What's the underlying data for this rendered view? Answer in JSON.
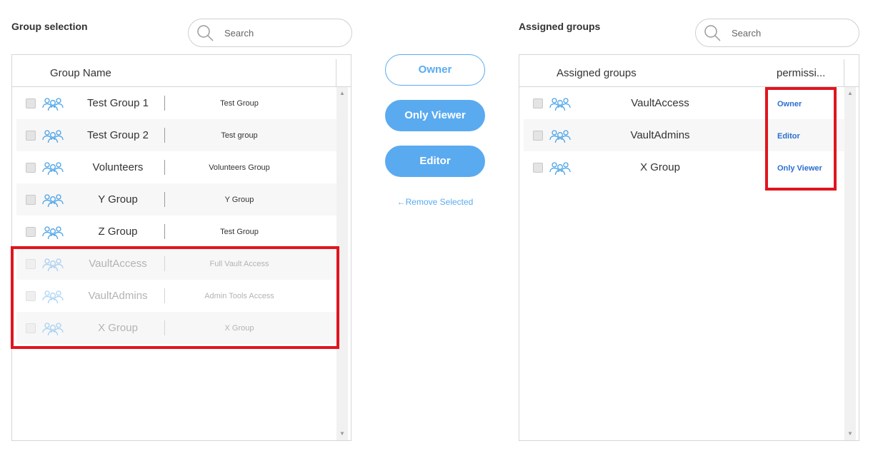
{
  "left": {
    "title": "Group selection",
    "search_placeholder": "Search",
    "header": {
      "name": "Group Name"
    },
    "rows": [
      {
        "name": "Test Group 1",
        "desc": "Test Group"
      },
      {
        "name": "Test Group 2",
        "desc": "Test group"
      },
      {
        "name": "Volunteers",
        "desc": "Volunteers Group"
      },
      {
        "name": "Y Group",
        "desc": "Y Group"
      },
      {
        "name": "Z Group",
        "desc": "Test Group"
      },
      {
        "name": "VaultAccess",
        "desc": "Full Vault Access"
      },
      {
        "name": "VaultAdmins",
        "desc": "Admin Tools Access"
      },
      {
        "name": "X Group",
        "desc": "X Group"
      }
    ]
  },
  "actions": {
    "owner": "Owner",
    "only_viewer": "Only Viewer",
    "editor": "Editor",
    "remove_selected": "←Remove Selected"
  },
  "right": {
    "title": "Assigned groups",
    "search_placeholder": "Search",
    "header": {
      "name": "Assigned groups",
      "permission": "permissi..."
    },
    "rows": [
      {
        "name": "VaultAccess",
        "permission": "Owner"
      },
      {
        "name": "VaultAdmins",
        "permission": "Editor"
      },
      {
        "name": "X Group",
        "permission": "Only Viewer"
      }
    ]
  },
  "colors": {
    "accent": "#5aaaf0",
    "link": "#2b6fcf",
    "highlight": "#e0151f"
  },
  "icons": {
    "search": "search-icon",
    "group": "group-icon",
    "scroll_up": "scroll-up-icon",
    "scroll_down": "scroll-down-icon"
  }
}
